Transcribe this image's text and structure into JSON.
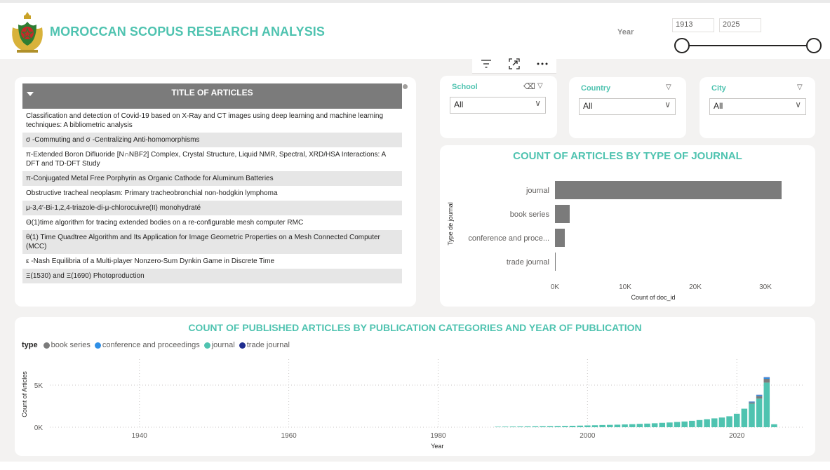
{
  "header": {
    "title": "MOROCCAN SCOPUS RESEARCH ANALYSIS",
    "year_label": "Year",
    "year_min": "1913",
    "year_max": "2025"
  },
  "articles": {
    "header": "TITLE OF ARTICLES",
    "rows": [
      "Classification and detection of Covid-19 based on X-Ray and CT images using deep learning and machine learning techniques: A bibliometric analysis",
      "σ -Commuting and σ -Centralizing Anti-homomorphisms",
      "π-Extended Boron Difluoride [N∩NBF2] Complex, Crystal Structure, Liquid NMR, Spectral, XRD/HSA Interactions: A DFT and TD-DFT Study",
      "π-Conjugated Metal Free Porphyrin as Organic Cathode for Aluminum Batteries",
      "Obstructive tracheal neoplasm: Primary tracheobronchial non-hodgkin lymphoma",
      "μ-3,4′-Bi-1,2,4-triazole-di-μ-chlorocuivre(II) monohydraté",
      "Θ(1)time algorithm for tracing extended bodies on a re-configurable mesh computer RMC",
      "θ(1) Time Quadtree Algorithm and Its Application for Image Geometric Properties on a Mesh Connected Computer (MCC)",
      "ε -Nash Equilibria of a Multi-player Nonzero-Sum Dynkin Game in Discrete Time",
      "Ξ(1530) and Ξ(1690) Photoproduction"
    ]
  },
  "slicers": [
    {
      "title": "School",
      "value": "All"
    },
    {
      "title": "Country",
      "value": "All"
    },
    {
      "title": "City",
      "value": "All"
    }
  ],
  "colors": {
    "accent": "#4fc3b0",
    "bar": "#7b7b7b",
    "book_series": "#7b7b7b",
    "conference": "#2f8fe6",
    "journal": "#4fc3b0",
    "trade_journal": "#1f2d8f"
  },
  "chart_data": [
    {
      "type": "bar",
      "orientation": "horizontal",
      "title": "COUNT OF ARTICLES BY TYPE OF JOURNAL",
      "xlabel": "Count of doc_id",
      "ylabel": "Type de journal",
      "categories": [
        "journal",
        "book series",
        "conference and proce...",
        "trade journal"
      ],
      "values": [
        32300,
        2100,
        1400,
        80
      ],
      "xticks": [
        "0K",
        "10K",
        "20K",
        "30K"
      ],
      "xlim": [
        0,
        33000
      ]
    },
    {
      "type": "bar",
      "stacked": true,
      "title": "COUNT OF PUBLISHED ARTICLES BY PUBLICATION CATEGORIES AND YEAR OF PUBLICATION",
      "xlabel": "Year",
      "ylabel": "Count of Articles",
      "legend_title": "type",
      "legend": [
        "book series",
        "conference and proceedings",
        "journal",
        "trade journal"
      ],
      "xticks": [
        "1940",
        "1960",
        "1980",
        "2000",
        "2020"
      ],
      "yticks": [
        "0K",
        "5K"
      ],
      "ylim": [
        0,
        7000
      ],
      "x": [
        1988,
        1989,
        1990,
        1991,
        1992,
        1993,
        1994,
        1995,
        1996,
        1997,
        1998,
        1999,
        2000,
        2001,
        2002,
        2003,
        2004,
        2005,
        2006,
        2007,
        2008,
        2009,
        2010,
        2011,
        2012,
        2013,
        2014,
        2015,
        2016,
        2017,
        2018,
        2019,
        2020,
        2021,
        2022,
        2023,
        2024,
        2025
      ],
      "series": [
        {
          "name": "journal",
          "values": [
            60,
            70,
            80,
            90,
            100,
            110,
            120,
            130,
            140,
            150,
            170,
            190,
            210,
            230,
            260,
            280,
            300,
            330,
            360,
            400,
            430,
            470,
            520,
            560,
            620,
            680,
            760,
            850,
            950,
            1050,
            1150,
            1300,
            1600,
            2200,
            2800,
            3400,
            5300,
            350
          ]
        },
        {
          "name": "book series",
          "values": [
            0,
            0,
            0,
            0,
            0,
            0,
            0,
            0,
            0,
            0,
            0,
            0,
            0,
            0,
            0,
            0,
            0,
            0,
            0,
            0,
            0,
            0,
            0,
            0,
            0,
            0,
            0,
            0,
            0,
            0,
            0,
            0,
            0,
            0,
            150,
            300,
            450,
            0
          ]
        },
        {
          "name": "conference and proceedings",
          "values": [
            0,
            0,
            0,
            0,
            0,
            0,
            0,
            0,
            0,
            0,
            0,
            0,
            0,
            0,
            0,
            0,
            0,
            0,
            0,
            0,
            0,
            0,
            0,
            0,
            0,
            0,
            0,
            0,
            0,
            0,
            0,
            0,
            0,
            0,
            80,
            120,
            150,
            0
          ]
        },
        {
          "name": "trade journal",
          "values": [
            0,
            0,
            0,
            0,
            0,
            0,
            0,
            0,
            0,
            0,
            0,
            0,
            0,
            0,
            0,
            0,
            0,
            0,
            0,
            0,
            0,
            0,
            0,
            0,
            0,
            0,
            0,
            0,
            0,
            0,
            0,
            0,
            0,
            0,
            20,
            30,
            40,
            0
          ]
        }
      ]
    }
  ]
}
